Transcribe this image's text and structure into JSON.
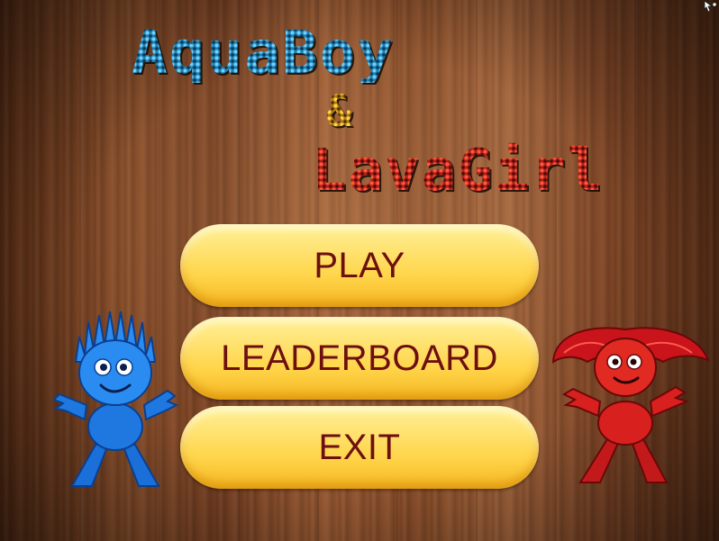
{
  "title": {
    "line1": "AquaBoy",
    "ampersand": "&",
    "line2": "LavaGirl"
  },
  "menu": {
    "play_label": "PLAY",
    "leaderboard_label": "LEADERBOARD",
    "exit_label": "EXIT"
  },
  "characters": {
    "left": "aquaboy-character-icon",
    "right": "lavagirl-character-icon"
  },
  "colors": {
    "button_fill": "#ffd54a",
    "button_text": "#6e0f0f",
    "aqua": "#1e78e0",
    "lava": "#d8201e",
    "amp": "#e8b020"
  }
}
